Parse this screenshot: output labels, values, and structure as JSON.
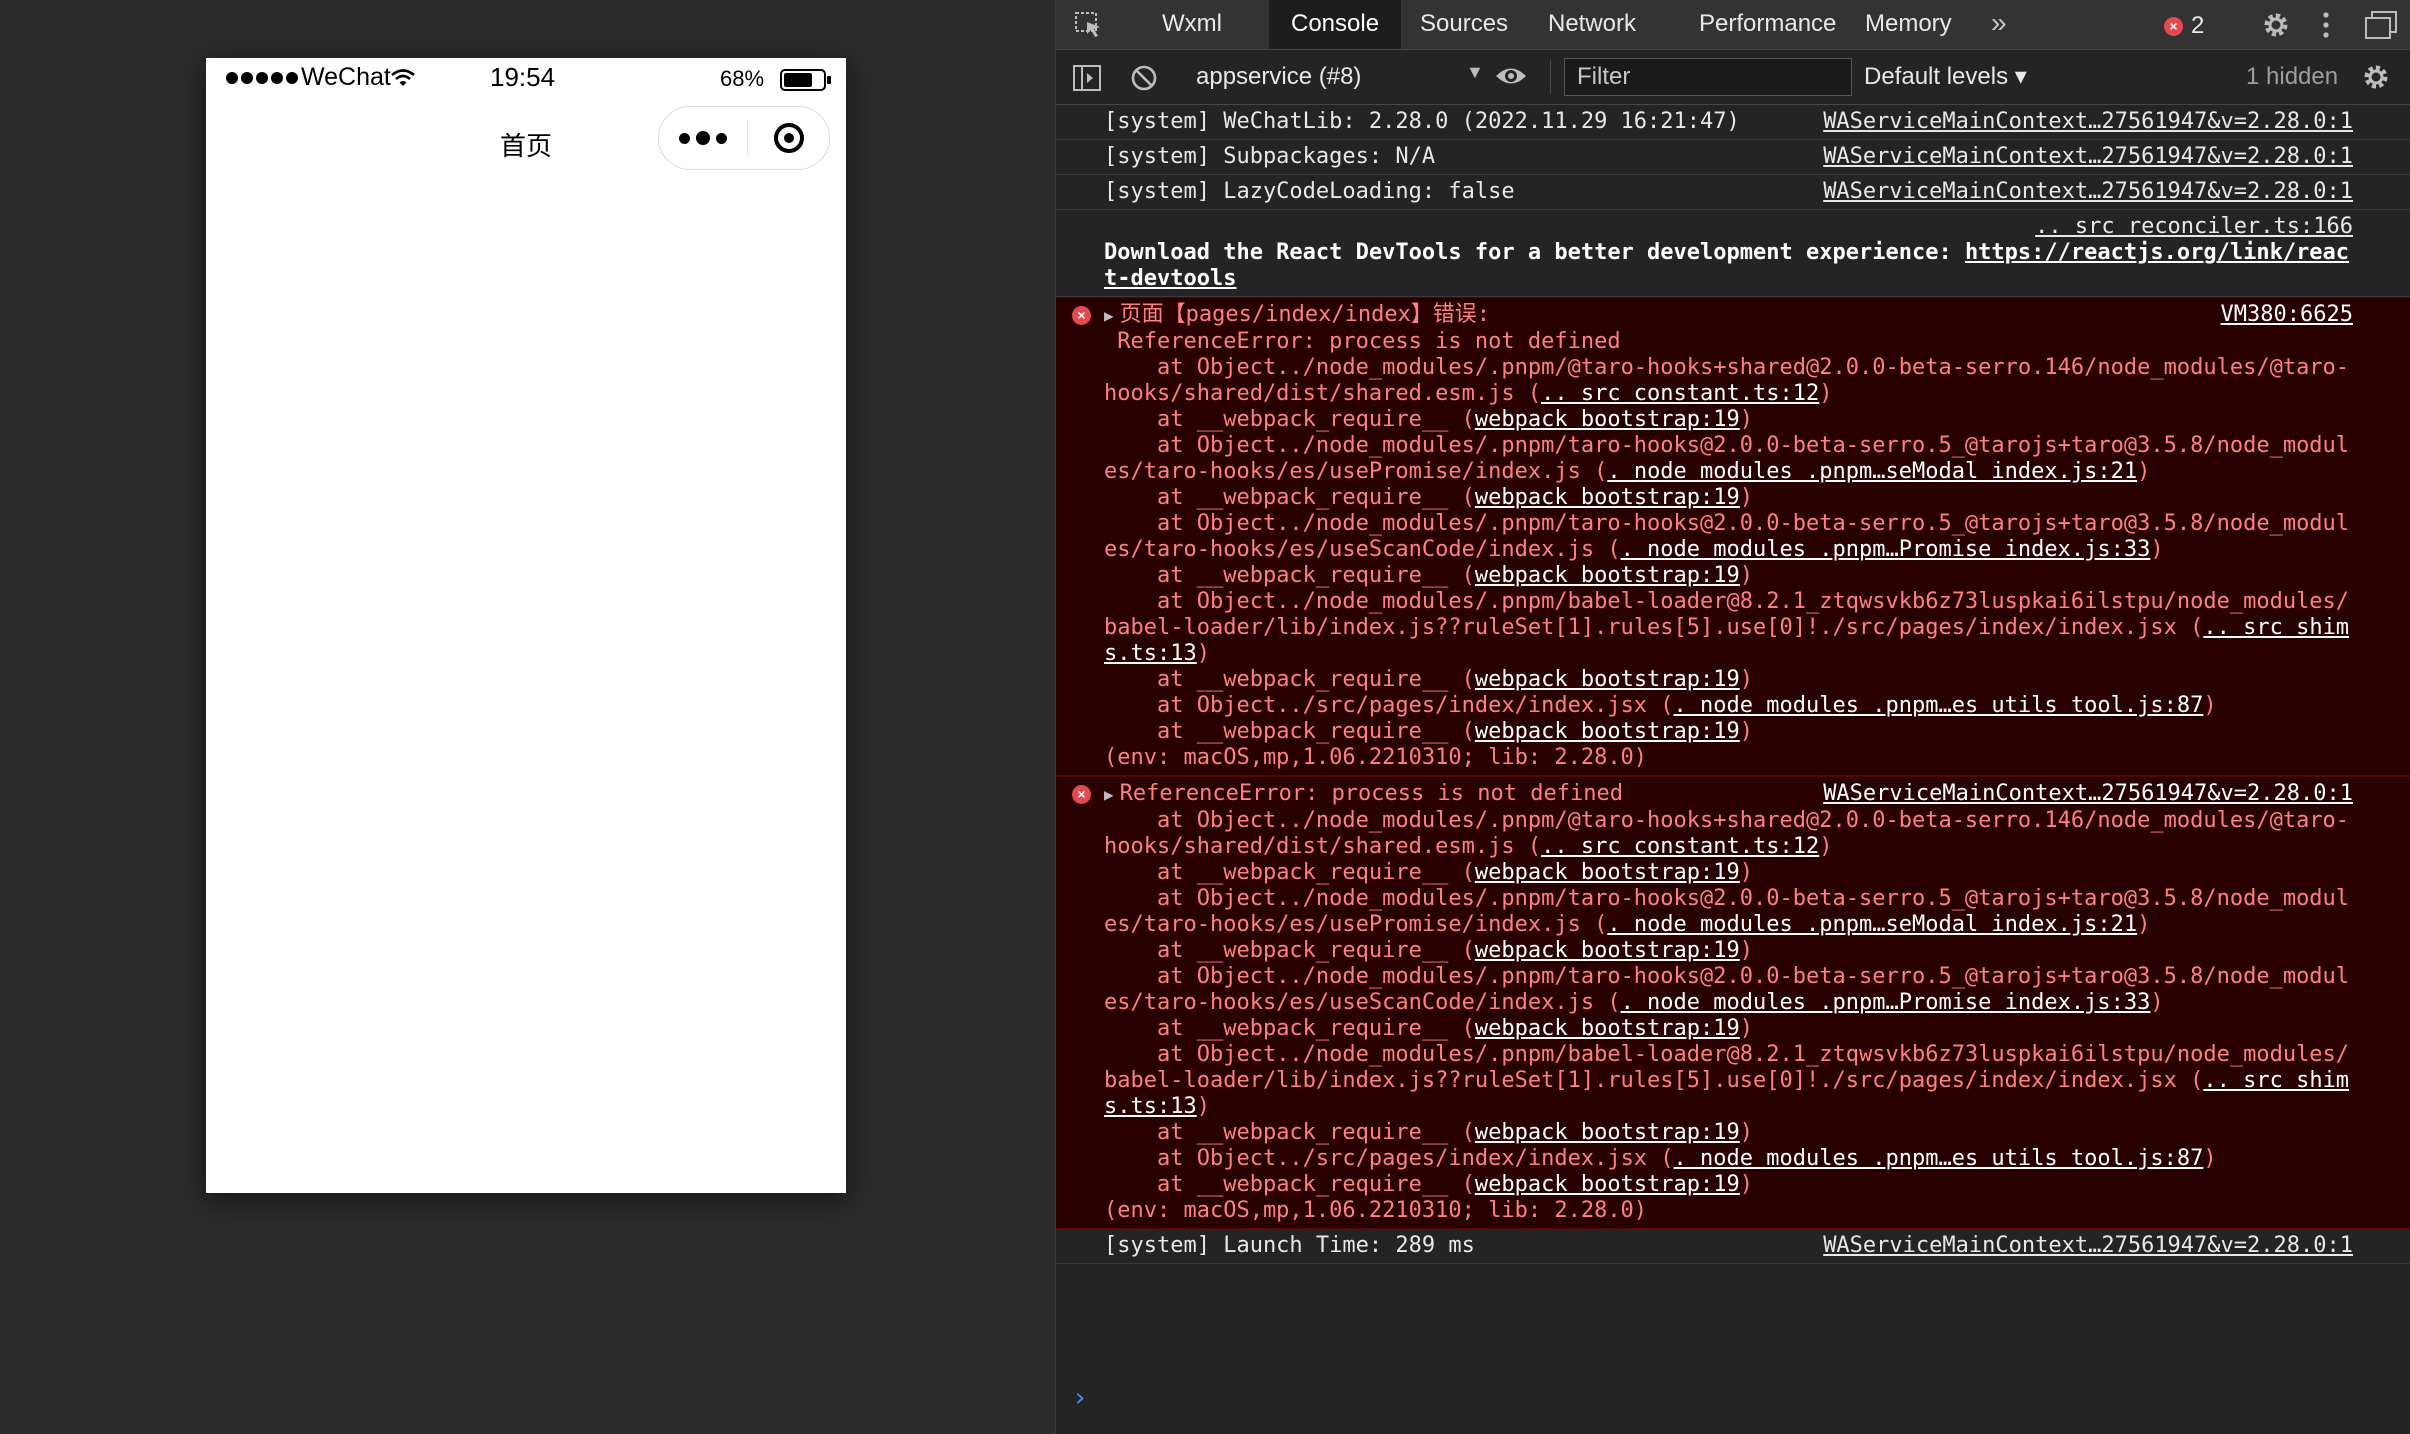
{
  "simulator": {
    "status_bar": {
      "carrier": "WeChat",
      "time": "19:54",
      "battery": "68%"
    },
    "nav_title": "首页"
  },
  "devtools": {
    "tabs": [
      {
        "label": "Wxml",
        "active": false
      },
      {
        "label": "Console",
        "active": true
      },
      {
        "label": "Sources",
        "active": false
      },
      {
        "label": "Network",
        "active": false
      },
      {
        "label": "Performance",
        "active": false
      },
      {
        "label": "Memory",
        "active": false
      }
    ],
    "tab_overflow": "»",
    "error_count": "2",
    "toolbar": {
      "context": "appservice (#8)",
      "filter_placeholder": "Filter",
      "levels": "Default levels ▾",
      "hidden": "1 hidden"
    },
    "colors": {
      "error_bg": "#290000",
      "error_text": "#ff8080",
      "prompt": "#3e8ef7"
    }
  },
  "console": {
    "system_messages": [
      {
        "text": "[system] WeChatLib: 2.28.0 (2022.11.29 16:21:47)",
        "src": "WAServiceMainContext…27561947&v=2.28.0:1"
      },
      {
        "text": "[system] Subpackages: N/A",
        "src": "WAServiceMainContext…27561947&v=2.28.0:1"
      },
      {
        "text": "[system] LazyCodeLoading: false",
        "src": "WAServiceMainContext…27561947&v=2.28.0:1"
      }
    ],
    "react_tip": {
      "src": ".. src reconciler.ts:166",
      "text": "Download the React DevTools for a better development experience: ",
      "link": "https://reactjs.org/link/react-devtools"
    },
    "error1": {
      "header": "页面【pages/index/index】错误:",
      "src": "VM380:6625",
      "message": " ReferenceError: process is not defined"
    },
    "error2": {
      "header": "ReferenceError: process is not defined",
      "src": "WAServiceMainContext…27561947&v=2.28.0:1"
    },
    "stack": [
      {
        "text": "    at Object../node_modules/.pnpm/@taro-hooks+shared@2.0.0-beta-serro.146/node_modules/@taro-hooks/shared/dist/shared.esm.js (",
        "link": ".. src constant.ts:12",
        "tail": ")"
      },
      {
        "text": "    at __webpack_require__ (",
        "link": "webpack bootstrap:19",
        "tail": ")"
      },
      {
        "text": "    at Object../node_modules/.pnpm/taro-hooks@2.0.0-beta-serro.5_@tarojs+taro@3.5.8/node_modules/taro-hooks/es/usePromise/index.js (",
        "link": ". node modules .pnpm…seModal index.js:21",
        "tail": ")"
      },
      {
        "text": "    at __webpack_require__ (",
        "link": "webpack bootstrap:19",
        "tail": ")"
      },
      {
        "text": "    at Object../node_modules/.pnpm/taro-hooks@2.0.0-beta-serro.5_@tarojs+taro@3.5.8/node_modules/taro-hooks/es/useScanCode/index.js (",
        "link": ". node modules .pnpm…Promise index.js:33",
        "tail": ")"
      },
      {
        "text": "    at __webpack_require__ (",
        "link": "webpack bootstrap:19",
        "tail": ")"
      },
      {
        "text": "    at Object../node_modules/.pnpm/babel-loader@8.2.1_ztqwsvkb6z73luspkai6ilstpu/node_modules/babel-loader/lib/index.js??ruleSet[1].rules[5].use[0]!./src/pages/index/index.jsx (",
        "link": ".. src shims.ts:13",
        "tail": ")"
      },
      {
        "text": "    at __webpack_require__ (",
        "link": "webpack bootstrap:19",
        "tail": ")"
      },
      {
        "text": "    at Object../src/pages/index/index.jsx (",
        "link": ". node modules .pnpm…es utils tool.js:87",
        "tail": ")"
      },
      {
        "text": "    at __webpack_require__ (",
        "link": "webpack bootstrap:19",
        "tail": ")"
      },
      {
        "text": "(env: macOS,mp,1.06.2210310; lib: 2.28.0)",
        "link": "",
        "tail": ""
      }
    ],
    "launch": {
      "text": "[system] Launch Time: 289 ms",
      "src": "WAServiceMainContext…27561947&v=2.28.0:1"
    },
    "prompt": "›"
  }
}
